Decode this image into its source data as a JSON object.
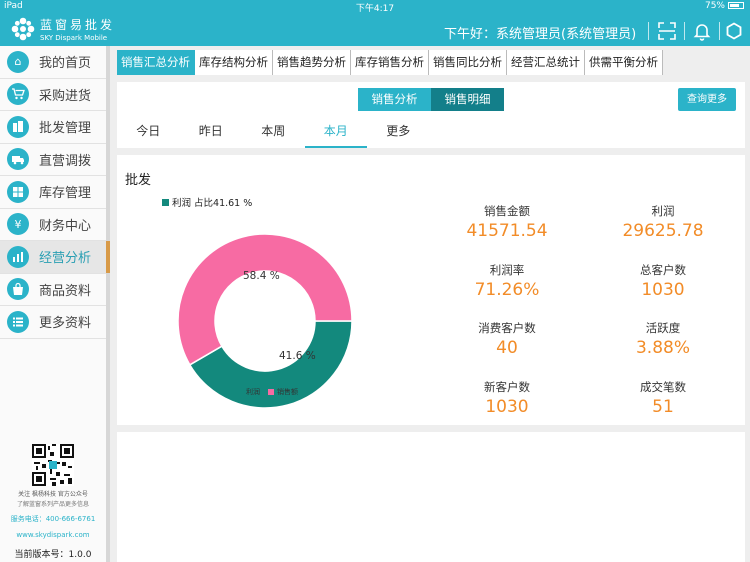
{
  "status_bar": {
    "device": "iPad",
    "time": "下午4:17",
    "battery": "75%"
  },
  "header": {
    "brand_cn": "蓝窗易批发",
    "brand_en": "SKY Dispark Mobile",
    "greeting": "下午好：系统管理员(系统管理员)"
  },
  "sidebar": {
    "items": [
      {
        "label": "我的首页",
        "icon": "home-icon"
      },
      {
        "label": "采购进货",
        "icon": "cart-icon"
      },
      {
        "label": "批发管理",
        "icon": "building-icon"
      },
      {
        "label": "直营调拨",
        "icon": "truck-icon"
      },
      {
        "label": "库存管理",
        "icon": "grid-icon"
      },
      {
        "label": "财务中心",
        "icon": "yen-icon"
      },
      {
        "label": "经营分析",
        "icon": "chart-icon"
      },
      {
        "label": "商品资料",
        "icon": "bag-icon"
      },
      {
        "label": "更多资料",
        "icon": "list-icon"
      }
    ],
    "active_index": 6,
    "footer": {
      "follow": "关注 枫杨科技 官方公众号",
      "learn": "了解蓝窗系列产品更多信息",
      "phone": "服务电话：400-666-6761",
      "website": "www.skydispark.com",
      "version": "当前版本号：1.0.0"
    }
  },
  "tabs": [
    "销售汇总分析",
    "库存结构分析",
    "销售趋势分析",
    "库存销售分析",
    "销售同比分析",
    "经营汇总统计",
    "供需平衡分析"
  ],
  "active_tab": 0,
  "segment": {
    "analysis": "销售分析",
    "detail": "销售明细"
  },
  "query_more": "查询更多",
  "periods": [
    "今日",
    "昨日",
    "本周",
    "本月",
    "更多"
  ],
  "active_period": 3,
  "card": {
    "title": "批发",
    "legend_top": "利润 占比41.61 %",
    "label_pink": "58.4 %",
    "label_teal": "41.6 %",
    "legend_bottom": [
      "利润",
      "销售额"
    ]
  },
  "chart_data": {
    "type": "pie",
    "categories": [
      "利润",
      "销售额"
    ],
    "values": [
      41.6,
      58.4
    ],
    "colors": [
      "#13897d",
      "#f76ba3"
    ]
  },
  "metrics": [
    {
      "label": "销售金额",
      "value": "41571.54"
    },
    {
      "label": "利润",
      "value": "29625.78"
    },
    {
      "label": "利润率",
      "value": "71.26%"
    },
    {
      "label": "总客户数",
      "value": "1030"
    },
    {
      "label": "消费客户数",
      "value": "40"
    },
    {
      "label": "活跃度",
      "value": "3.88%"
    },
    {
      "label": "新客户数",
      "value": "1030"
    },
    {
      "label": "成交笔数",
      "value": "51"
    }
  ]
}
